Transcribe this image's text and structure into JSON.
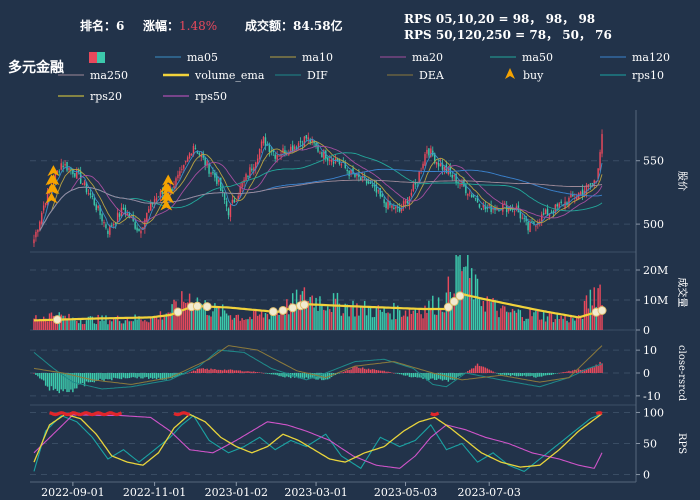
{
  "header": {
    "rank_label": "排名：",
    "rank_value": "6",
    "change_label": "涨幅：",
    "change_value": "1.48%",
    "turnover_label": "成交额：",
    "turnover_value": "84.58亿",
    "rps_line1": "RPS 05,10,20 = 98， 98， 98",
    "rps_line2": "RPS 50,120,250 = 78， 50， 76"
  },
  "stock_name": "多元金融",
  "colors": {
    "background": "#22334a",
    "up": "#e8495c",
    "down": "#3cc9ac",
    "volume_ema": "#f2d33b",
    "buy": "#f5a300",
    "rps20": "#e8d43c",
    "rps50": "#cf54c9",
    "rps10": "#1aa3a3"
  },
  "legend": [
    {
      "name": "ma05",
      "color": "#3a8fc7",
      "kind": "line"
    },
    {
      "name": "ma10",
      "color": "#b7a242",
      "kind": "line"
    },
    {
      "name": "ma20",
      "color": "#a44e9f",
      "kind": "line"
    },
    {
      "name": "ma50",
      "color": "#22a79a",
      "kind": "line"
    },
    {
      "name": "ma120",
      "color": "#3b83cf",
      "kind": "line"
    },
    {
      "name": "ma250",
      "color": "#9e8a98",
      "kind": "line"
    },
    {
      "name": "volume_ema",
      "color": "#f2d33b",
      "kind": "line"
    },
    {
      "name": "DIF",
      "color": "#1f8a8a",
      "kind": "line"
    },
    {
      "name": "DEA",
      "color": "#8c7a3c",
      "kind": "line"
    },
    {
      "name": "buy",
      "color": "#f5a300",
      "kind": "marker"
    },
    {
      "name": "rps10",
      "color": "#1aa3a3",
      "kind": "line"
    },
    {
      "name": "rps20",
      "color": "#e8d43c",
      "kind": "line"
    },
    {
      "name": "rps50",
      "color": "#cf54c9",
      "kind": "line"
    }
  ],
  "chart_data": [
    {
      "type": "candlestick",
      "ylabel": "股价",
      "yticks": [
        500,
        550
      ],
      "ylim": [
        478,
        590
      ],
      "grid": true,
      "anchors": [
        [
          0,
          488
        ],
        [
          6,
          520
        ],
        [
          14,
          548
        ],
        [
          22,
          540
        ],
        [
          30,
          520
        ],
        [
          38,
          495
        ],
        [
          46,
          512
        ],
        [
          54,
          495
        ],
        [
          62,
          520
        ],
        [
          70,
          528
        ],
        [
          76,
          540
        ],
        [
          82,
          563
        ],
        [
          88,
          548
        ],
        [
          94,
          535
        ],
        [
          100,
          510
        ],
        [
          106,
          528
        ],
        [
          112,
          545
        ],
        [
          118,
          566
        ],
        [
          124,
          555
        ],
        [
          132,
          560
        ],
        [
          140,
          568
        ],
        [
          148,
          556
        ],
        [
          156,
          550
        ],
        [
          164,
          538
        ],
        [
          172,
          532
        ],
        [
          180,
          517
        ],
        [
          188,
          510
        ],
        [
          196,
          530
        ],
        [
          202,
          560
        ],
        [
          208,
          548
        ],
        [
          216,
          536
        ],
        [
          224,
          525
        ],
        [
          232,
          512
        ],
        [
          240,
          514
        ],
        [
          248,
          512
        ],
        [
          254,
          496
        ],
        [
          260,
          505
        ],
        [
          268,
          512
        ],
        [
          276,
          520
        ],
        [
          284,
          528
        ],
        [
          289,
          535
        ],
        [
          292,
          572
        ]
      ],
      "buy_points": [
        9,
        10,
        68,
        69
      ]
    },
    {
      "type": "bar",
      "ylabel": "成交量",
      "yticks": [
        "0",
        "10M",
        "20M"
      ],
      "ylim": [
        0,
        25
      ],
      "volume_anchors": [
        [
          0,
          4
        ],
        [
          10,
          5
        ],
        [
          20,
          3.5
        ],
        [
          40,
          3.5
        ],
        [
          62,
          4
        ],
        [
          72,
          7
        ],
        [
          80,
          11
        ],
        [
          90,
          7
        ],
        [
          110,
          4
        ],
        [
          125,
          6
        ],
        [
          140,
          11
        ],
        [
          160,
          8
        ],
        [
          180,
          6
        ],
        [
          200,
          7
        ],
        [
          212,
          10
        ],
        [
          218,
          25
        ],
        [
          228,
          12
        ],
        [
          240,
          6
        ],
        [
          260,
          5
        ],
        [
          280,
          3.5
        ],
        [
          288,
          13
        ],
        [
          292,
          14
        ]
      ],
      "ema_anchors": [
        [
          0,
          3.2
        ],
        [
          30,
          3.8
        ],
        [
          60,
          4.2
        ],
        [
          70,
          5
        ],
        [
          82,
          8
        ],
        [
          100,
          7.5
        ],
        [
          125,
          6
        ],
        [
          140,
          8.6
        ],
        [
          160,
          8
        ],
        [
          200,
          7
        ],
        [
          212,
          7
        ],
        [
          220,
          12
        ],
        [
          230,
          10.5
        ],
        [
          260,
          6.5
        ],
        [
          280,
          4.2
        ],
        [
          292,
          6.5
        ]
      ],
      "markers": [
        12,
        74,
        81,
        84,
        89,
        123,
        128,
        133,
        137,
        139,
        213,
        216,
        219,
        289,
        292
      ]
    },
    {
      "type": "line",
      "ylabel": "close-rsrcd",
      "yticks": [
        -10,
        0,
        10
      ],
      "ylim": [
        -14,
        14
      ],
      "dif_anchors": [
        [
          0,
          9
        ],
        [
          10,
          2
        ],
        [
          20,
          -4
        ],
        [
          35,
          -7
        ],
        [
          50,
          -6
        ],
        [
          70,
          -3
        ],
        [
          85,
          3
        ],
        [
          95,
          10
        ],
        [
          108,
          9
        ],
        [
          122,
          2
        ],
        [
          140,
          -3
        ],
        [
          150,
          0
        ],
        [
          165,
          5
        ],
        [
          180,
          6
        ],
        [
          195,
          2
        ],
        [
          205,
          -5
        ],
        [
          212,
          -6
        ],
        [
          222,
          0
        ],
        [
          240,
          -3
        ],
        [
          260,
          -6
        ],
        [
          275,
          -2
        ],
        [
          285,
          2
        ],
        [
          292,
          4
        ]
      ],
      "dea_anchors": [
        [
          0,
          2
        ],
        [
          15,
          0
        ],
        [
          30,
          -3
        ],
        [
          50,
          -5
        ],
        [
          70,
          -2
        ],
        [
          90,
          6
        ],
        [
          100,
          12
        ],
        [
          115,
          10
        ],
        [
          135,
          1
        ],
        [
          150,
          -2
        ],
        [
          165,
          3
        ],
        [
          185,
          5
        ],
        [
          205,
          0
        ],
        [
          220,
          -3
        ],
        [
          240,
          -1
        ],
        [
          260,
          -4
        ],
        [
          275,
          -2
        ],
        [
          292,
          12
        ]
      ],
      "macd_anchors": [
        [
          0,
          0
        ],
        [
          10,
          -9
        ],
        [
          20,
          -8
        ],
        [
          30,
          -4
        ],
        [
          50,
          -2
        ],
        [
          70,
          -3
        ],
        [
          85,
          2
        ],
        [
          100,
          1.5
        ],
        [
          115,
          0.5
        ],
        [
          130,
          -2
        ],
        [
          150,
          -3
        ],
        [
          165,
          3
        ],
        [
          180,
          1
        ],
        [
          200,
          -3
        ],
        [
          215,
          -4
        ],
        [
          228,
          4
        ],
        [
          240,
          -1
        ],
        [
          260,
          -2
        ],
        [
          275,
          1
        ],
        [
          285,
          2
        ],
        [
          292,
          5
        ]
      ]
    },
    {
      "type": "line",
      "ylabel": "RPS",
      "yticks": [
        0,
        50,
        100
      ],
      "ylim": [
        -12,
        112
      ],
      "rps10_anchors": [
        [
          0,
          5
        ],
        [
          6,
          70
        ],
        [
          14,
          95
        ],
        [
          22,
          85
        ],
        [
          30,
          60
        ],
        [
          38,
          25
        ],
        [
          46,
          40
        ],
        [
          54,
          20
        ],
        [
          62,
          40
        ],
        [
          70,
          60
        ],
        [
          76,
          80
        ],
        [
          82,
          95
        ],
        [
          90,
          55
        ],
        [
          100,
          35
        ],
        [
          108,
          45
        ],
        [
          116,
          60
        ],
        [
          124,
          40
        ],
        [
          132,
          55
        ],
        [
          140,
          45
        ],
        [
          150,
          65
        ],
        [
          158,
          30
        ],
        [
          168,
          10
        ],
        [
          178,
          60
        ],
        [
          188,
          45
        ],
        [
          196,
          55
        ],
        [
          204,
          80
        ],
        [
          212,
          40
        ],
        [
          220,
          50
        ],
        [
          228,
          20
        ],
        [
          236,
          35
        ],
        [
          244,
          15
        ],
        [
          252,
          5
        ],
        [
          260,
          25
        ],
        [
          268,
          45
        ],
        [
          278,
          70
        ],
        [
          286,
          90
        ],
        [
          292,
          98
        ]
      ],
      "rps20_anchors": [
        [
          0,
          20
        ],
        [
          8,
          80
        ],
        [
          16,
          97
        ],
        [
          24,
          90
        ],
        [
          32,
          65
        ],
        [
          40,
          30
        ],
        [
          48,
          20
        ],
        [
          56,
          15
        ],
        [
          64,
          35
        ],
        [
          72,
          75
        ],
        [
          80,
          97
        ],
        [
          88,
          85
        ],
        [
          96,
          60
        ],
        [
          104,
          45
        ],
        [
          112,
          35
        ],
        [
          120,
          45
        ],
        [
          128,
          65
        ],
        [
          136,
          55
        ],
        [
          144,
          40
        ],
        [
          152,
          25
        ],
        [
          160,
          20
        ],
        [
          170,
          35
        ],
        [
          180,
          45
        ],
        [
          190,
          70
        ],
        [
          198,
          85
        ],
        [
          206,
          92
        ],
        [
          214,
          75
        ],
        [
          222,
          55
        ],
        [
          230,
          35
        ],
        [
          240,
          20
        ],
        [
          250,
          12
        ],
        [
          260,
          15
        ],
        [
          270,
          40
        ],
        [
          280,
          70
        ],
        [
          292,
          98
        ]
      ],
      "rps50_anchors": [
        [
          0,
          35
        ],
        [
          20,
          96
        ],
        [
          45,
          95
        ],
        [
          60,
          92
        ],
        [
          70,
          70
        ],
        [
          80,
          40
        ],
        [
          92,
          35
        ],
        [
          104,
          55
        ],
        [
          112,
          70
        ],
        [
          120,
          85
        ],
        [
          130,
          80
        ],
        [
          140,
          70
        ],
        [
          152,
          55
        ],
        [
          164,
          30
        ],
        [
          176,
          15
        ],
        [
          188,
          10
        ],
        [
          196,
          30
        ],
        [
          204,
          60
        ],
        [
          212,
          80
        ],
        [
          222,
          72
        ],
        [
          232,
          60
        ],
        [
          244,
          50
        ],
        [
          256,
          35
        ],
        [
          270,
          25
        ],
        [
          280,
          15
        ],
        [
          288,
          10
        ],
        [
          292,
          35
        ]
      ],
      "red_zones": [
        [
          8,
          45
        ],
        [
          72,
          80
        ],
        [
          204,
          208
        ],
        [
          289,
          292
        ]
      ]
    }
  ],
  "x_axis": {
    "tick_labels": [
      "2022-09-01",
      "2022-11-01",
      "2023-01-02",
      "2023-03-01",
      "2023-05-03",
      "2023-07-03"
    ],
    "tick_index": [
      20,
      62,
      104,
      145,
      191,
      234
    ]
  }
}
